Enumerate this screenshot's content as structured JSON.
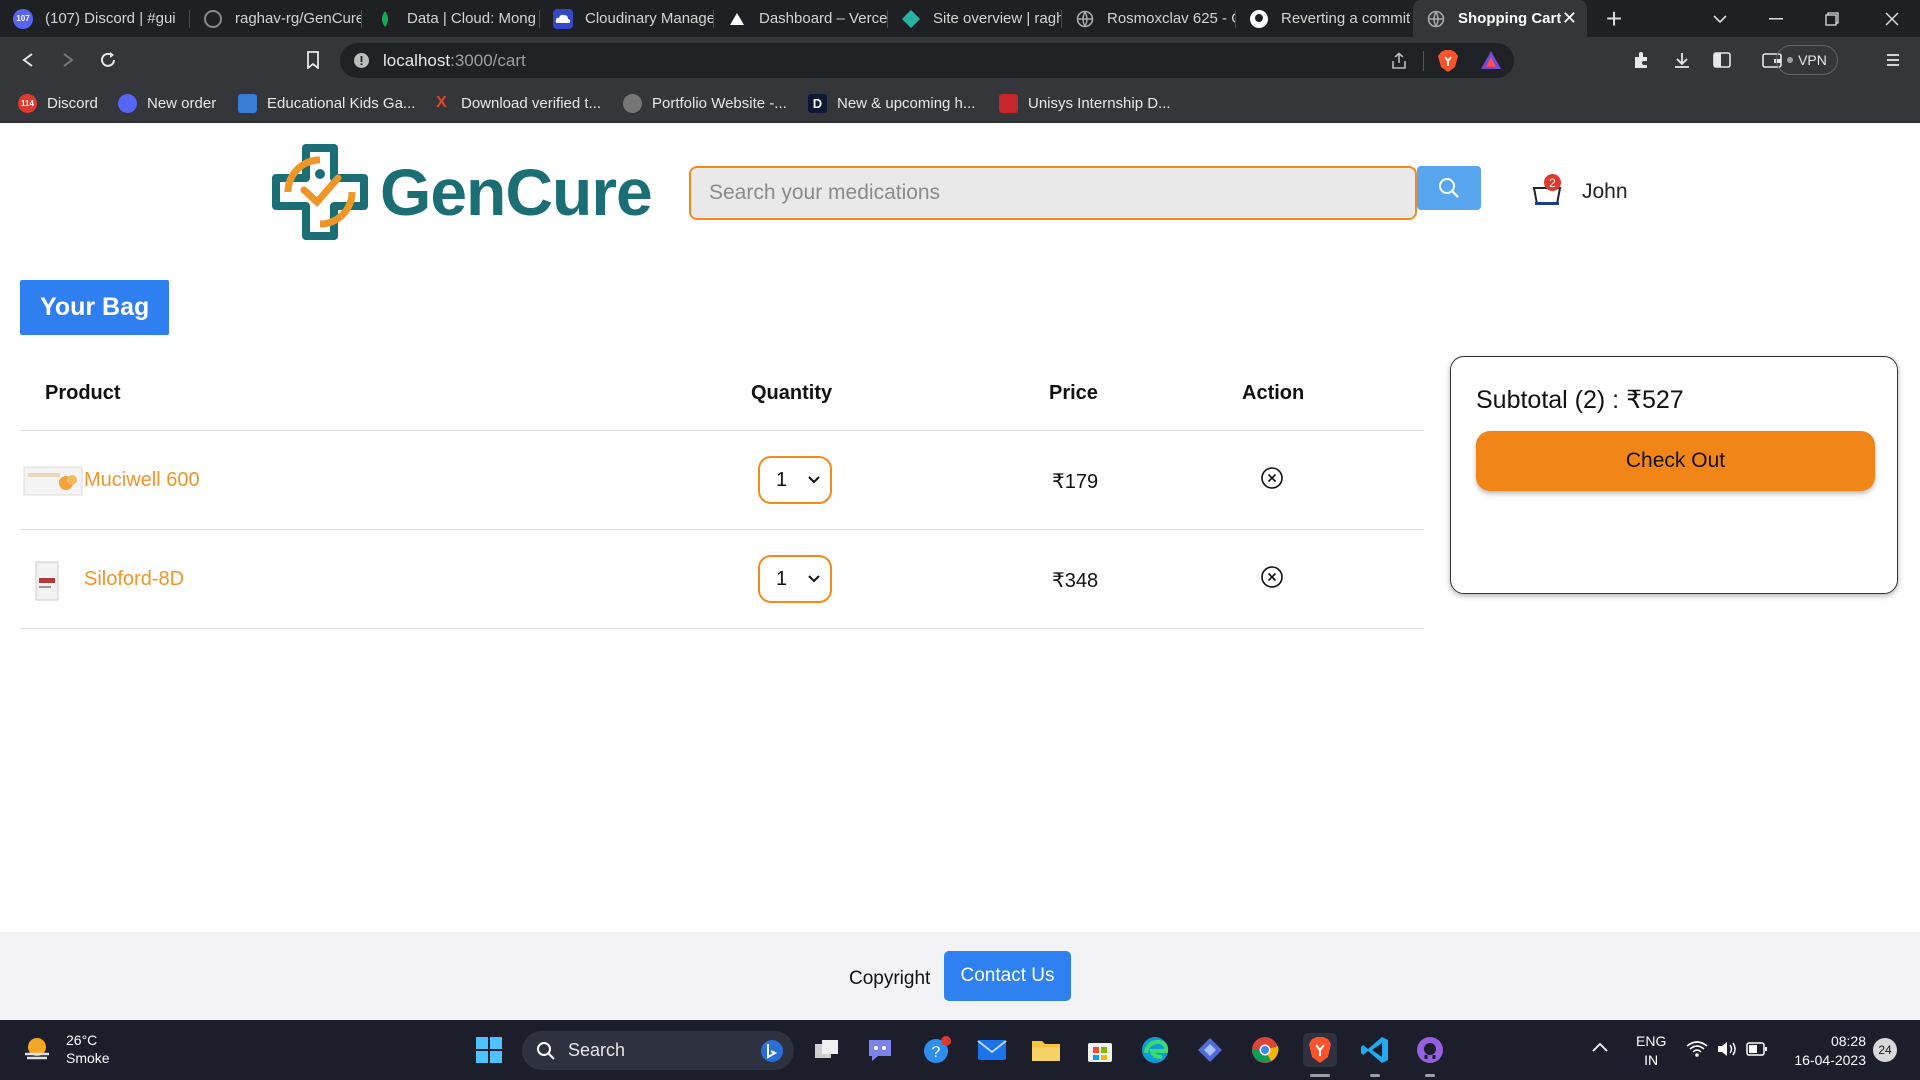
{
  "browser": {
    "tabs": [
      {
        "title": "(107) Discord | #gui",
        "badge": "107",
        "color": "#5865f2"
      },
      {
        "title": "raghav-rg/GenCure",
        "color": "#444"
      },
      {
        "title": "Data | Cloud: Mong",
        "color": "#13aa52"
      },
      {
        "title": "Cloudinary Manage",
        "color": "#3448c5"
      },
      {
        "title": "Dashboard – Vercel",
        "color": "#000"
      },
      {
        "title": "Site overview | ragh",
        "color": "#25b3a5"
      },
      {
        "title": "Rosmoxclav 625 - G",
        "color": "#888"
      },
      {
        "title": "Reverting a commit",
        "color": "#fff"
      },
      {
        "title": "Shopping Cart",
        "color": "#888",
        "active": true
      }
    ],
    "url_host": "localhost",
    "url_path": ":3000/cart",
    "vpn_label": "VPN",
    "bookmarks": [
      {
        "label": "Discord",
        "color": "#e03a2f",
        "badge": "114"
      },
      {
        "label": "New order",
        "color": "#5865f2"
      },
      {
        "label": "Educational Kids Ga...",
        "color": "#3a7bd5"
      },
      {
        "label": "Download verified t...",
        "color": "#d9482b",
        "glyph": "X"
      },
      {
        "label": "Portfolio Website -...",
        "color": "#777"
      },
      {
        "label": "New & upcoming h...",
        "color": "#0e1a33",
        "glyph": "D"
      },
      {
        "label": "Unisys Internship D...",
        "color": "#c4282d"
      }
    ]
  },
  "header": {
    "brand": "GenCure",
    "search_placeholder": "Search your medications",
    "cart_count": "2",
    "user_name": "John"
  },
  "cart": {
    "title": "Your Bag",
    "columns": {
      "product": "Product",
      "quantity": "Quantity",
      "price": "Price",
      "action": "Action"
    },
    "items": [
      {
        "name": "Muciwell 600",
        "quantity": "1",
        "price": "₹179"
      },
      {
        "name": "Siloford-8D",
        "quantity": "1",
        "price": "₹348"
      }
    ],
    "subtotal_label": "Subtotal (2) : ₹527",
    "checkout_label": "Check Out"
  },
  "footer": {
    "copyright": "Copyright",
    "contact_label": "Contact Us"
  },
  "taskbar": {
    "weather_temp": "26°C",
    "weather_desc": "Smoke",
    "search_label": "Search",
    "lang_line1": "ENG",
    "lang_line2": "IN",
    "time": "08:28",
    "date": "16-04-2023",
    "notifications": "24"
  }
}
